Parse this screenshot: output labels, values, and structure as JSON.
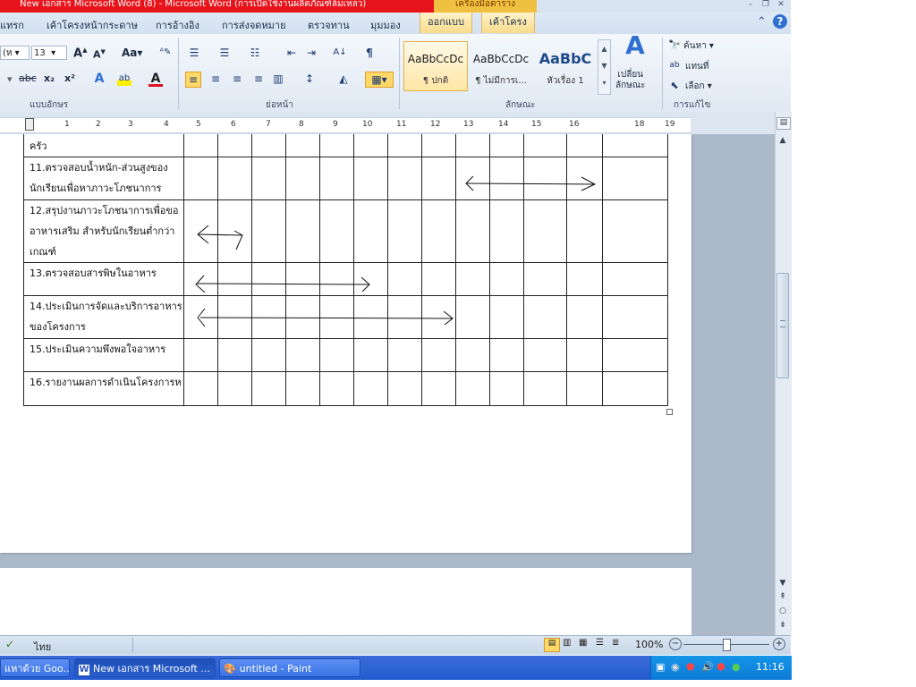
{
  "window": {
    "title": "New เอกสาร Microsoft Word (8)  - Microsoft Word (การเปิดใช้งานผลิตภัณฑ์ล้มเหลว)",
    "context_tab_title": "เครื่องมือตาราง",
    "min": "–",
    "restore": "❐",
    "close": "✕"
  },
  "ribbon_tabs": [
    "แทรก",
    "เค้าโครงหน้ากระดาษ",
    "การอ้างอิง",
    "การส่งจดหมาย",
    "ตรวจทาน",
    "มุมมอง",
    "ออกแบบ",
    "เค้าโครง"
  ],
  "ribbon": {
    "font_name": "(ห",
    "font_size": "13",
    "grow_font": "A",
    "shrink_font": "A",
    "change_case": "Aa",
    "strike": "abc",
    "subscript": "x₂",
    "superscript": "x²",
    "font_group_label": "แบบอักษร",
    "paragraph_group_label": "ย่อหน้า",
    "styles_group_label": "ลักษณะ",
    "editing_group_label": "การแก้ไข",
    "styles": [
      {
        "sample": "AaBbCcDc",
        "name": "¶ ปกติ"
      },
      {
        "sample": "AaBbCcDc",
        "name": "¶ ไม่มีการเ..."
      },
      {
        "sample": "AaBbC",
        "name": "หัวเรื่อง 1"
      }
    ],
    "change_styles": "เปลี่ยน\nลักษณะ",
    "find": "ค้นหา",
    "replace": "แทนที่",
    "select": "เลือก"
  },
  "ruler": [
    "1",
    "2",
    "3",
    "4",
    "5",
    "6",
    "7",
    "8",
    "9",
    "10",
    "11",
    "12",
    "13",
    "14",
    "15",
    "16",
    "18",
    "19"
  ],
  "table": {
    "rows": [
      {
        "text": "ครัว",
        "lines": 1
      },
      {
        "text": "11.ตรวจสอบน้ำหนัก-ส่วนสูงของนักเรียนเพื่อหาภาวะโภชนาการ",
        "lines": 2
      },
      {
        "text": "12.สรุปงานภาวะโภชนาการเพื่อขออาหารเสริม สำหรับนักเรียนต่ำกว่าเกณฑ์",
        "lines": 3
      },
      {
        "text": "13.ตรวจสอบสารพิษในอาหาร",
        "lines": 1
      },
      {
        "text": "14.ประเมินการจัดและบริการอาหารของโครงการ",
        "lines": 2
      },
      {
        "text": "15.ประเมินความพึงพอใจอาหาร",
        "lines": 1
      },
      {
        "text": "16.รายงานผลการดำเนินโครงการห",
        "lines": 1
      }
    ]
  },
  "status": {
    "language": "ไทย",
    "zoom": "100%"
  },
  "taskbar": {
    "buttons": [
      "แหาด้วย Goo...",
      "New เอกสาร Microsoft ...",
      "untitled - Paint"
    ],
    "clock": "11:16"
  },
  "colors": {
    "title_red": "#e8141c",
    "context_tab": "#f0c040",
    "taskbar_blue": "#245bd0"
  }
}
